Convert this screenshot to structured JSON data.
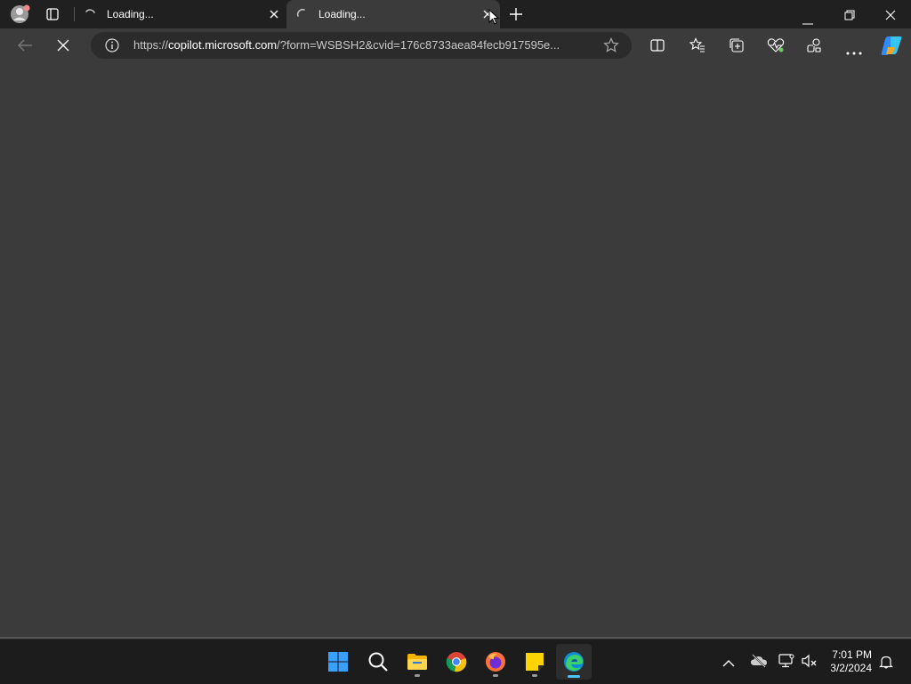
{
  "browser": {
    "tabs": [
      {
        "title": "Loading...",
        "active": false
      },
      {
        "title": "Loading...",
        "active": true
      }
    ],
    "address": {
      "scheme": "https://",
      "host": "copilot.microsoft.com",
      "path": "/?form=WSBSH2&cvid=176c8733aea84fecb917595e..."
    }
  },
  "taskbar": {
    "apps": [
      "start-icon",
      "search-icon",
      "file-explorer-icon",
      "chrome-icon",
      "firefox-icon",
      "sticky-notes-icon",
      "edge-icon"
    ],
    "clock": {
      "time": "7:01 PM",
      "date": "3/2/2024"
    }
  },
  "colors": {
    "accent": "#4cc2ff",
    "titlebar": "#202020",
    "toolbar": "#3b3b3b",
    "taskbar": "#1c1c1c"
  }
}
